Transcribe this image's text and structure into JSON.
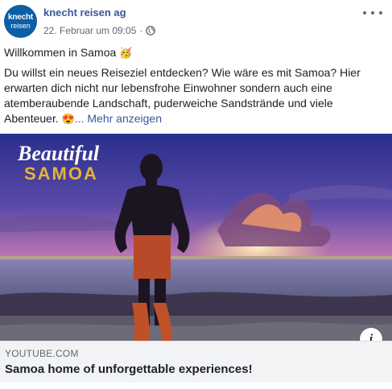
{
  "post": {
    "avatar": {
      "line1": "knecht",
      "line2": "reisen"
    },
    "author": "knecht reisen ag",
    "date": "22. Februar um 09:05",
    "audience_icon": "globe-icon",
    "more_icon": "more-options-icon",
    "title_text": "Willkommen in Samoa",
    "title_emoji": "🥳",
    "body_text": "Du willst ein neues Reiseziel entdecken? Wie wäre es mit Samoa? Hier erwarten dich nicht nur lebensfrohe Einwohner sondern auch eine atemberaubende Landschaft, puderweiche Sandstrände und viele Abenteuer.",
    "body_emoji": "😍",
    "see_more_label": "... Mehr anzeigen"
  },
  "media": {
    "overlay_title": "Beautiful",
    "overlay_subtitle": "SAMOA",
    "info_icon_label": "i"
  },
  "link": {
    "domain": "YOUTUBE.COM",
    "title": "Samoa home of unforgettable experiences!"
  },
  "colors": {
    "brand": "#0a5fa5",
    "link": "#385898",
    "footer_bg": "#f2f3f5"
  }
}
